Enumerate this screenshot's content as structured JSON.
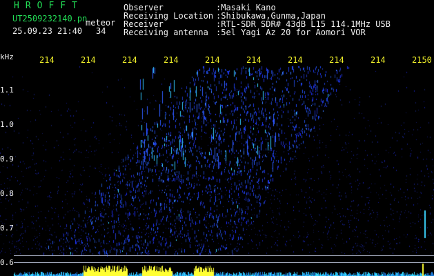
{
  "header": {
    "brand": "HROFFT",
    "filename": "UT2509232140.pn",
    "mode": "meteor",
    "datetime": "25.09.23 21:40",
    "count": "34"
  },
  "info": [
    {
      "label": "Observer",
      "value": ":Masaki Kano"
    },
    {
      "label": "Receiving Location",
      "value": ":Shibukawa,Gunma,Japan"
    },
    {
      "label": "Receiver",
      "value": ":RTL-SDR SDR# 43dB L15 114.1MHz USB"
    },
    {
      "label": "Receiving antenna",
      "value": ":5el Yagi Az 20 for Aomori VOR"
    }
  ],
  "x_axis": {
    "ticks": [
      "214",
      "214",
      "214",
      "214",
      "214",
      "214",
      "214",
      "214",
      "214",
      "2150"
    ]
  },
  "y_axis": {
    "unit": "kHz",
    "ticks": [
      "1.1",
      "1.0",
      "0.9",
      "0.8",
      "0.7",
      "0.6"
    ]
  },
  "colors": {
    "background": "#000000",
    "header_green": "#22dd55",
    "header_white": "#f0f0f0",
    "tick_yellow": "#f2f22a",
    "signal_blue": "#2a3cff",
    "signal_cyan": "#3cd6ff",
    "level_yellow": "#ffff33"
  }
}
